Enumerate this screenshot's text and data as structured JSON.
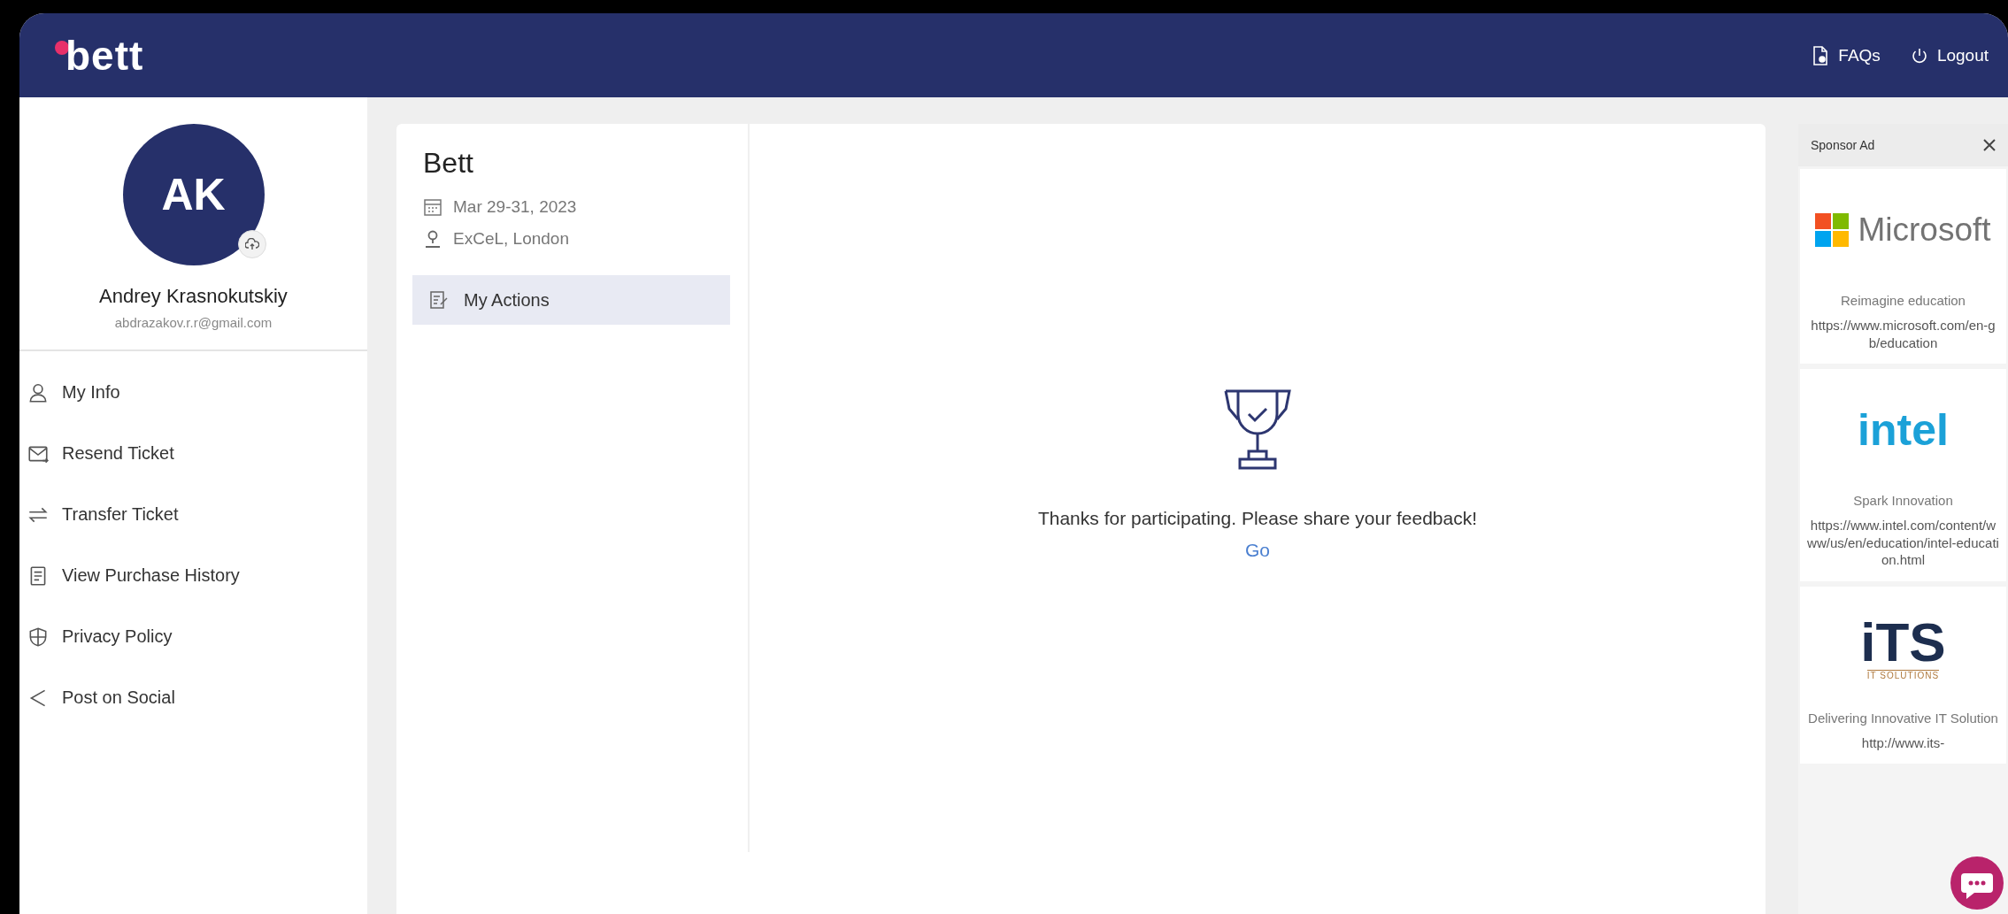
{
  "header": {
    "logo": "bett",
    "links": [
      {
        "kind": "faq",
        "label": "FAQs"
      },
      {
        "kind": "logout",
        "label": "Logout"
      }
    ]
  },
  "profile": {
    "initials": "AK",
    "name": "Andrey Krasnokutskiy",
    "email": "abdrazakov.r.r@gmail.com"
  },
  "menu": [
    {
      "kind": "person",
      "label": "My Info"
    },
    {
      "kind": "mail",
      "label": "Resend Ticket"
    },
    {
      "kind": "transfer",
      "label": "Transfer Ticket"
    },
    {
      "kind": "receipt",
      "label": "View Purchase History"
    },
    {
      "kind": "shield",
      "label": "Privacy Policy"
    },
    {
      "kind": "share",
      "label": "Post on Social"
    }
  ],
  "event": {
    "title": "Bett",
    "date": "Mar 29-31, 2023",
    "venue": "ExCeL, London",
    "nav": [
      {
        "label": "My Actions",
        "selected": true
      }
    ],
    "message": "Thanks for participating. Please share your feedback!",
    "link": "Go"
  },
  "sponsor_ads": {
    "title": "Sponsor Ad",
    "ads": [
      {
        "kind": "microsoft",
        "logo": "Microsoft",
        "tagline": "Reimagine education",
        "url": "https://www.microsoft.com/en-gb/education"
      },
      {
        "kind": "intel",
        "logo": "intel",
        "tagline": "Spark Innovation",
        "url": "https://www.intel.com/content/www/us/en/education/intel-education.html"
      },
      {
        "kind": "its",
        "logo": "iTS",
        "logo_sub": "IT SOLUTIONS",
        "tagline": "Delivering Innovative IT Solution",
        "url": "http://www.its-"
      }
    ]
  }
}
